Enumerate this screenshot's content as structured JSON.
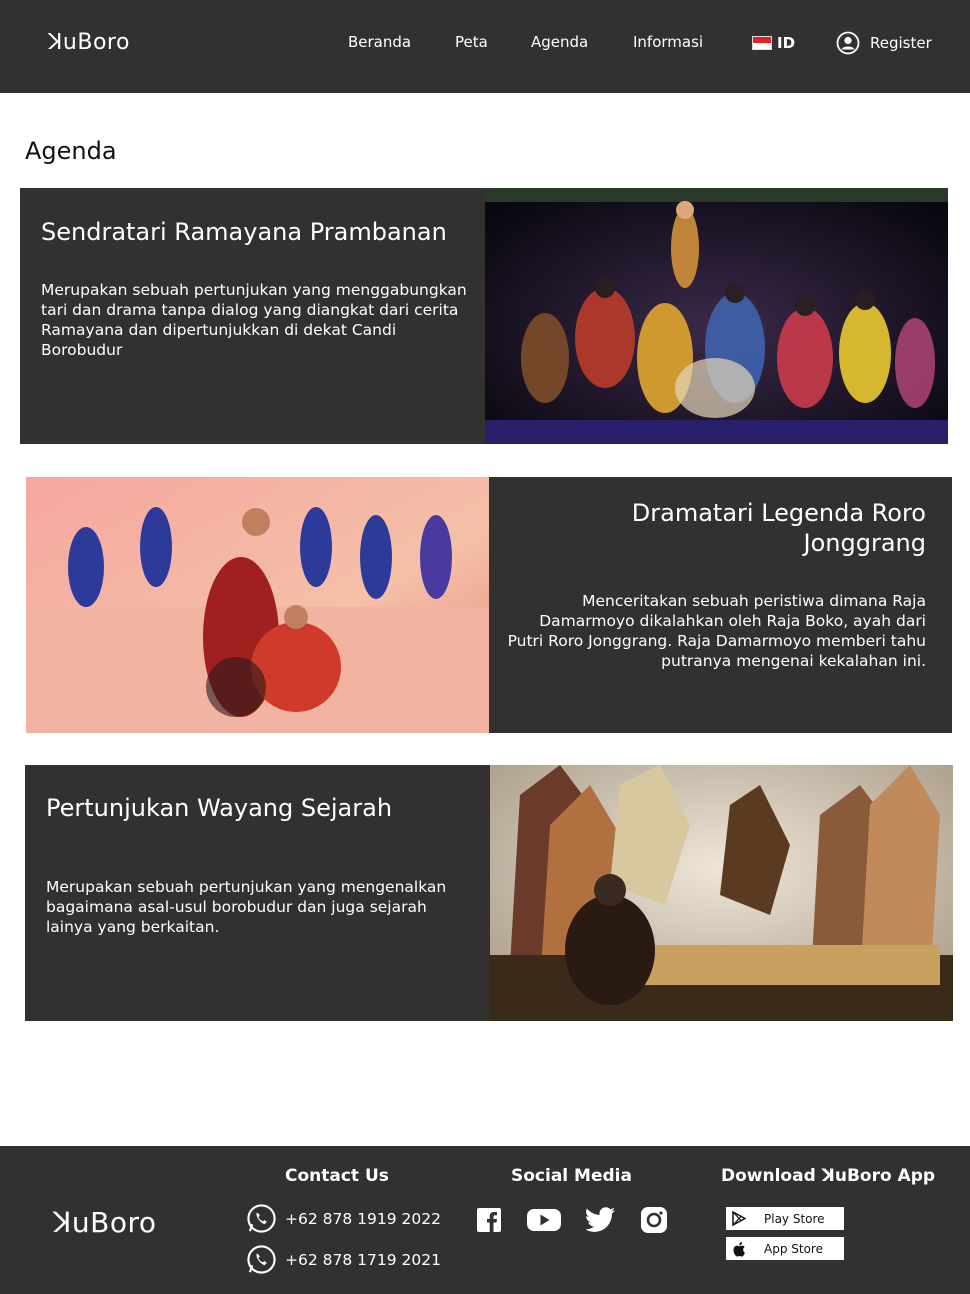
{
  "header": {
    "logo": "ꓘuBoro",
    "nav": [
      "Beranda",
      "Peta",
      "Agenda",
      "Informasi"
    ],
    "language": "ID",
    "register": "Register"
  },
  "page": {
    "title": "Agenda"
  },
  "events": [
    {
      "title": "Sendratari Ramayana Prambanan",
      "description": "Merupakan sebuah pertunjukan yang menggabungkan tari dan drama tanpa dialog yang diangkat dari cerita Ramayana dan dipertunjukkan di dekat Candi Borobudur"
    },
    {
      "title": "Dramatari Legenda Roro Jonggrang",
      "description": "Menceritakan sebuah peristiwa dimana Raja Damarmoyo dikalahkan oleh Raja Boko, ayah dari Putri Roro Jonggrang. Raja Damarmoyo memberi tahu putranya mengenai kekalahan ini."
    },
    {
      "title": "Pertunjukan Wayang Sejarah",
      "description": "Merupakan sebuah pertunjukan yang mengenalkan bagaimana asal-usul borobudur dan juga sejarah lainya yang berkaitan."
    }
  ],
  "footer": {
    "logo": "ꓘuBoro",
    "contact_heading": "Contact Us",
    "phones": [
      "+62 878 1919 2022",
      "+62 878 1719 2021"
    ],
    "social_heading": "Social Media",
    "social_icons": [
      "facebook-icon",
      "youtube-icon",
      "twitter-icon",
      "instagram-icon"
    ],
    "download_heading": "Download ꓘuBoro App",
    "stores": [
      "Play Store",
      "App Store"
    ]
  },
  "colors": {
    "dark": "#323130",
    "white": "#ffffff"
  }
}
